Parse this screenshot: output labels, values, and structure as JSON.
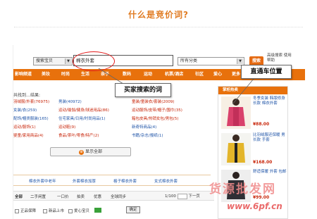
{
  "page_title": "什么是竞价词?",
  "search": {
    "scope": "搜索宝贝",
    "query": "棉衣外套",
    "category": "所有分类",
    "button": "搜索",
    "side_text": "高级搜索 使用帮助"
  },
  "nav": [
    "影响频道",
    "美妆",
    "时尚",
    "生活",
    "亲子",
    "数码",
    "运动",
    "机票/酒店",
    "社区",
    "爱心",
    "更多"
  ],
  "results_label": "共找到…结果:",
  "categories": [
    [
      "羽绒服/外套(76975)",
      "男装(40972)",
      "童装/童装衣/套装(2009)"
    ],
    [
      "女装/衣(259)",
      "运动/瑜伽/健身/球迷用品(86)",
      "运动服饰/皮带/帽子/围巾(35)"
    ],
    [
      "配饰/帽类服装(165)",
      "住宅家具/日用/时尚用品(1)",
      "箱包皮具/热销女包/男包(5)"
    ],
    [
      "运动/服饰(1)",
      "运动鞋(9)",
      "新奇特商品(4)"
    ],
    [
      "婴童/家用商品(4)",
      "食品/茶叶/零食/特产(2)",
      "书籍/杂志/报纸(1)"
    ]
  ],
  "more_button": "显示全部",
  "related": [
    "棉衣外套中老年",
    "外套棉衣加厚",
    "格子棉衣外套",
    "女式棉衣外套"
  ],
  "tabs": [
    "全部",
    "二手闲置",
    "一口价",
    "拍卖",
    "优惠",
    "全球同步"
  ],
  "pager": "1/100",
  "pager_next": "下一页",
  "filters": [
    "正品保障",
    "新品上市",
    "爱心宝贝"
  ],
  "confirm": "确定",
  "ads_header": "掌柜热卖",
  "ads": [
    {
      "text": "冬季女装 韩版修身 长款 棉衣外套",
      "price": "¥88.00"
    },
    {
      "text": "比羽绒服还保暖 男长款 手套",
      "price": "¥168.00"
    },
    {
      "text": "舒适保暖 外套 包邮",
      "price": "¥99.00"
    }
  ],
  "callouts": {
    "buyer": "买家搜索的词",
    "ztc": "直通车位置"
  },
  "watermark": "货源批发网",
  "watermark_url": "www.6pf.cn"
}
